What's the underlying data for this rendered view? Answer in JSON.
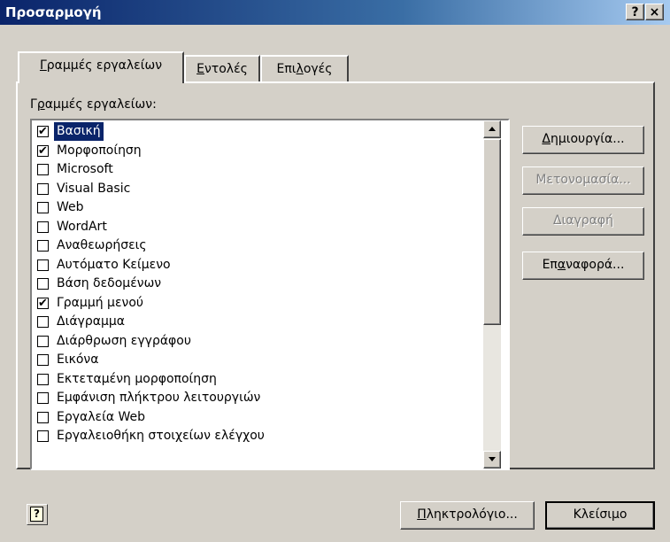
{
  "window": {
    "title": "Προσαρμογή",
    "help_glyph": "?",
    "close_glyph": "×"
  },
  "tabs": [
    {
      "pre": "",
      "key": "Γ",
      "post": "ραμμές εργαλείων",
      "active": true
    },
    {
      "pre": "",
      "key": "Ε",
      "post": "ντολές",
      "active": false
    },
    {
      "pre": "Επι",
      "key": "λ",
      "post": "ογές",
      "active": false
    }
  ],
  "list_label": {
    "pre": "Γ",
    "key": "ρ",
    "post": "αμμές εργαλείων:"
  },
  "toolbars": [
    {
      "label": "Βασική",
      "checked": true,
      "selected": true
    },
    {
      "label": "Μορφοποίηση",
      "checked": true,
      "selected": false
    },
    {
      "label": "Microsoft",
      "checked": false,
      "selected": false
    },
    {
      "label": "Visual Basic",
      "checked": false,
      "selected": false
    },
    {
      "label": "Web",
      "checked": false,
      "selected": false
    },
    {
      "label": "WordArt",
      "checked": false,
      "selected": false
    },
    {
      "label": "Αναθεωρήσεις",
      "checked": false,
      "selected": false
    },
    {
      "label": "Αυτόματο Κείμενο",
      "checked": false,
      "selected": false
    },
    {
      "label": "Βάση δεδομένων",
      "checked": false,
      "selected": false
    },
    {
      "label": "Γραμμή μενού",
      "checked": true,
      "selected": false
    },
    {
      "label": "Διάγραμμα",
      "checked": false,
      "selected": false
    },
    {
      "label": "Διάρθρωση εγγράφου",
      "checked": false,
      "selected": false
    },
    {
      "label": "Εικόνα",
      "checked": false,
      "selected": false
    },
    {
      "label": "Εκτεταμένη μορφοποίηση",
      "checked": false,
      "selected": false
    },
    {
      "label": "Εμφάνιση πλήκτρου λειτουργιών",
      "checked": false,
      "selected": false
    },
    {
      "label": "Εργαλεία Web",
      "checked": false,
      "selected": false
    },
    {
      "label": "Εργαλειοθήκη στοιχείων ελέγχου",
      "checked": false,
      "selected": false
    }
  ],
  "side_buttons": {
    "new": {
      "pre": "",
      "key": "Δ",
      "post": "ημιουργία...",
      "enabled": true
    },
    "rename": {
      "label": "Μετονομασία...",
      "enabled": false
    },
    "delete": {
      "label": "Διαγραφή",
      "enabled": false
    },
    "reset": {
      "pre": "Επ",
      "key": "α",
      "post": "ναφορά...",
      "enabled": true
    }
  },
  "bottom": {
    "help_glyph": "?",
    "keyboard": {
      "pre": "",
      "key": "Π",
      "post": "ληκτρολόγιο..."
    },
    "close": "Κλείσιμο"
  },
  "scroll": {
    "position": 0
  }
}
